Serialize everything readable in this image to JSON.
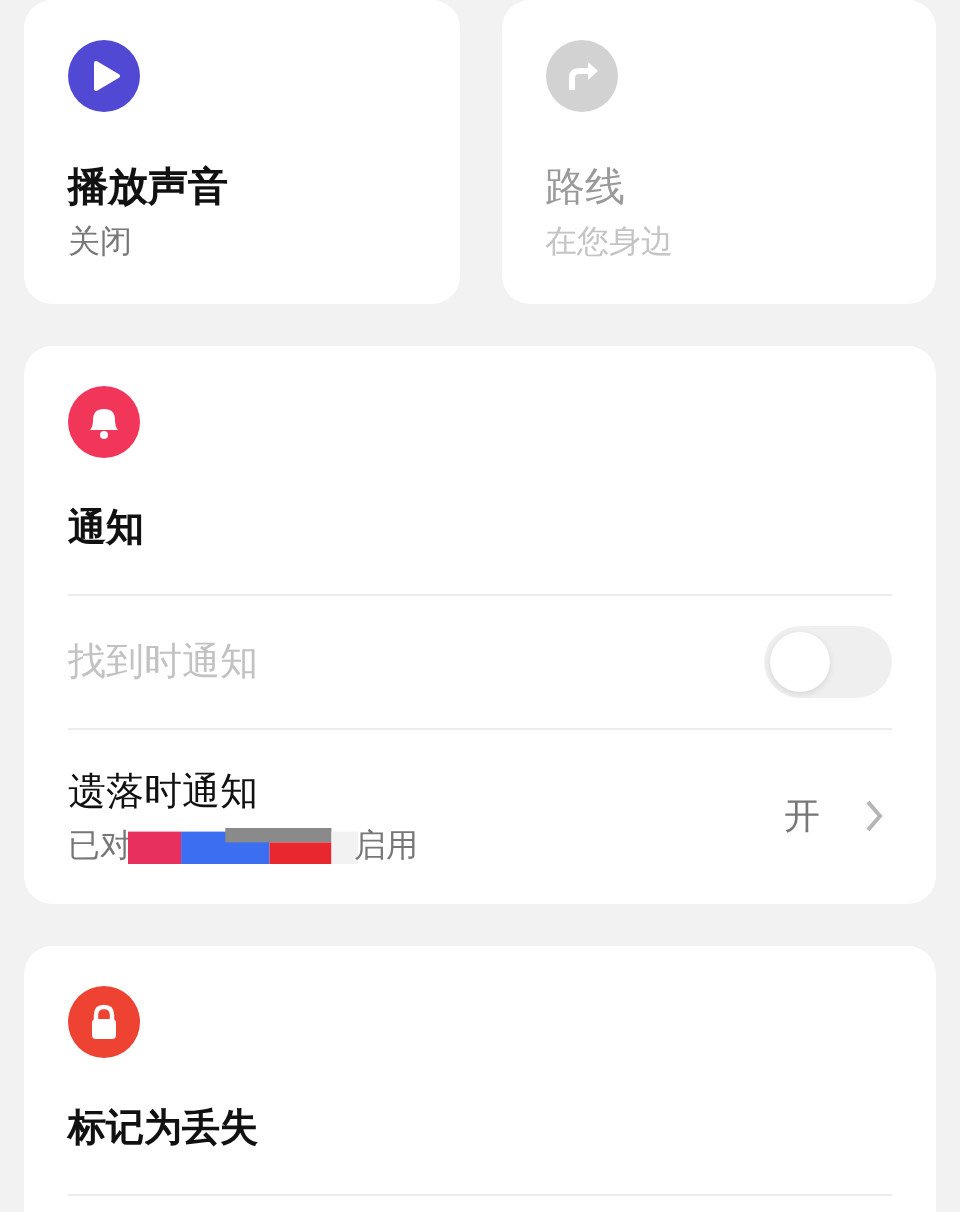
{
  "top_cards": [
    {
      "kind": "play",
      "title": "播放声音",
      "subtitle": "关闭",
      "disabled": false
    },
    {
      "kind": "route",
      "title": "路线",
      "subtitle": "在您身边",
      "disabled": true
    }
  ],
  "notifications": {
    "title": "通知",
    "rows": [
      {
        "kind": "toggle",
        "label": "找到时通知",
        "disabled": true,
        "on": false
      },
      {
        "kind": "link",
        "label": "遗落时通知",
        "subtitle_start": "已对",
        "subtitle_end": "启用",
        "value": "开",
        "disabled": false
      }
    ]
  },
  "mark_lost": {
    "title": "标记为丢失"
  }
}
